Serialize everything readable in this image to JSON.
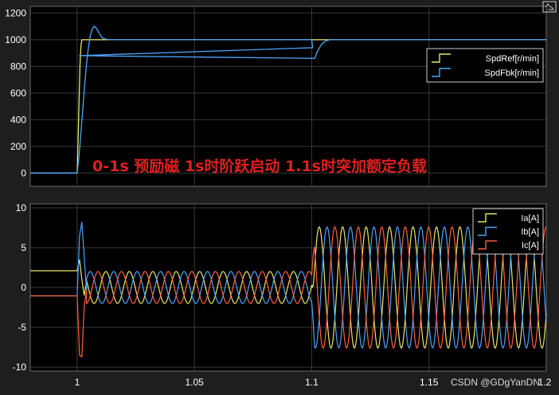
{
  "colors": {
    "figure_bg": "#1e1e1e",
    "axes_bg": "#000000",
    "grid": "#3a3a3a",
    "tick_text": "#ffffff",
    "annotation": "#e02020",
    "legend_bg": "#000000",
    "legend_border": "#ffffff"
  },
  "watermark": "CSDN @GDgYanDN",
  "corner_icon": "expand-icon",
  "chart_data": [
    {
      "type": "line",
      "title": "",
      "xlabel": "",
      "ylabel": "",
      "xlim": [
        0.98,
        1.2
      ],
      "ylim": [
        -100,
        1250
      ],
      "grid": true,
      "legend_placement": "top-right",
      "xticks": [
        1,
        1.05,
        1.1,
        1.15
      ],
      "yticks": [
        0,
        200,
        400,
        600,
        800,
        1000,
        1200
      ],
      "xtick_labels_visible": false,
      "annotation": "0-1s 预励磁  1s时阶跃启动  1.1s时突加额定负载",
      "series": [
        {
          "name": "SpdRef[r/min]",
          "color": "#e8e86a",
          "x": [
            0.98,
            1.0,
            1.0004,
            1.0008,
            1.0012,
            1.0016,
            1.002,
            1.2
          ],
          "y": [
            0,
            0,
            250,
            550,
            800,
            950,
            1000,
            1000
          ]
        },
        {
          "name": "SpdFbk[r/min]",
          "color": "#4da6ff",
          "x": [
            0.98,
            1.0,
            1.0008,
            1.0016,
            1.0024,
            1.0032,
            1.004,
            1.0048,
            1.0056,
            1.0064,
            1.0072,
            1.008,
            1.009,
            1.01,
            1.011,
            1.012,
            1.013,
            1.014,
            1.015,
            1.017,
            1.1,
            1.1004,
            1.0008,
            1.1012,
            1.1016,
            1.102,
            1.103,
            1.104,
            1.105,
            1.106,
            1.107,
            1.108,
            1.2
          ],
          "y": [
            0,
            0,
            130,
            300,
            480,
            660,
            820,
            940,
            1030,
            1080,
            1100,
            1090,
            1060,
            1030,
            1010,
            1005,
            1002,
            1000,
            1000,
            1000,
            1000,
            940,
            880,
            860,
            870,
            895,
            930,
            960,
            978,
            990,
            996,
            1000,
            1000
          ]
        }
      ]
    },
    {
      "type": "line",
      "title": "",
      "xlabel": "",
      "ylabel": "",
      "xlim": [
        0.98,
        1.2
      ],
      "ylim": [
        -10.5,
        10.5
      ],
      "grid": true,
      "legend_placement": "top-right",
      "xticks": [
        1,
        1.05,
        1.1,
        1.15
      ],
      "xtick_labels": [
        "1",
        "1.05",
        "1.1",
        "1.15",
        "1.2"
      ],
      "yticks": [
        -10,
        -5,
        0,
        5,
        10
      ],
      "phase_a_segments": {
        "pre_excitation": {
          "x_range": [
            0.98,
            1.0
          ],
          "Ia": 2.1,
          "Ib": -1.05,
          "Ic": -1.05
        },
        "start_transient": {
          "x": [
            1.0,
            1.001,
            1.002,
            1.003,
            1.004
          ],
          "Ia": [
            2.1,
            3.5,
            1.0,
            -1.0,
            0.8
          ],
          "Ib": [
            -1.05,
            6.5,
            8.2,
            4.0,
            -0.5
          ],
          "Ic": [
            -1.05,
            -8.5,
            -8.7,
            -2.5,
            -0.3
          ]
        },
        "no_load": {
          "x_range": [
            1.004,
            1.1
          ],
          "amplitude": 2.0,
          "frequency_hz": 100
        },
        "rated_load": {
          "x_range": [
            1.1,
            1.2
          ],
          "amplitude": 7.6,
          "frequency_hz": 100
        }
      },
      "series": [
        {
          "name": "Ia[A]",
          "color": "#e8e86a"
        },
        {
          "name": "Ib[A]",
          "color": "#4da6ff"
        },
        {
          "name": "Ic[A]",
          "color": "#ff6040"
        }
      ]
    }
  ]
}
